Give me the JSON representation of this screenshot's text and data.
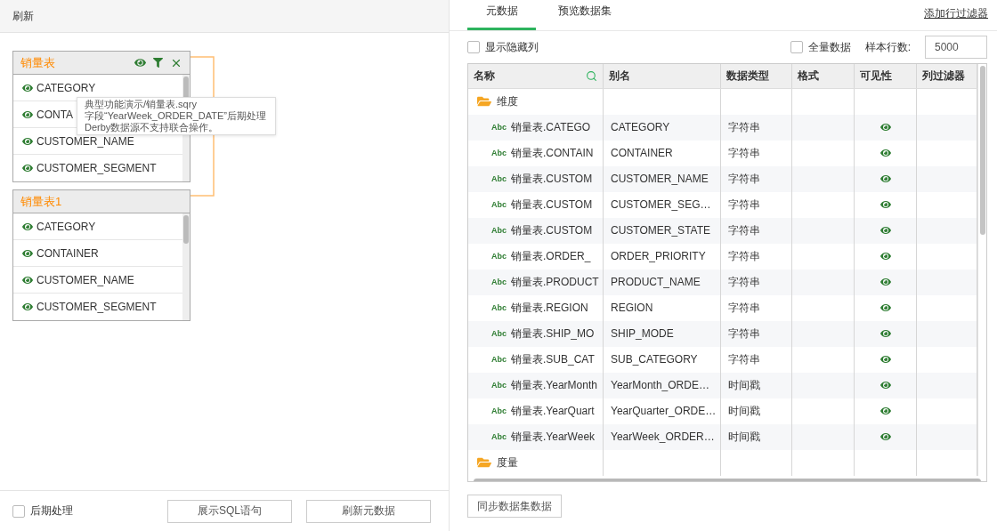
{
  "left_panel": {
    "toolbar": {
      "refresh": "刷新"
    },
    "tables": [
      {
        "title": "销量表",
        "actions": true,
        "fields": [
          {
            "name": "CATEGORY",
            "visible": true
          },
          {
            "name": "CONTA",
            "visible": true
          },
          {
            "name": "CUSTOMER_NAME",
            "visible": true
          },
          {
            "name": "CUSTOMER_SEGMENT",
            "visible": true
          }
        ]
      },
      {
        "title": "销量表1",
        "actions": false,
        "fields": [
          {
            "name": "CATEGORY",
            "visible": true
          },
          {
            "name": "CONTAINER",
            "visible": true
          },
          {
            "name": "CUSTOMER_NAME",
            "visible": true
          },
          {
            "name": "CUSTOMER_SEGMENT",
            "visible": true
          }
        ]
      }
    ],
    "tooltip": [
      "典型功能演示/销量表.sqry",
      "字段“YearWeek_ORDER_DATE”后期处理",
      "Derby数据源不支持联合操作。"
    ],
    "post_process": {
      "label": "后期处理",
      "checked": false
    },
    "buttons": [
      "展示SQL语句",
      "刷新元数据"
    ]
  },
  "right_panel": {
    "tabs": [
      {
        "label": "元数据",
        "selected": true
      },
      {
        "label": "预览数据集",
        "selected": false
      }
    ],
    "add_row_filter": "添加行过滤器",
    "show_hidden": {
      "label": "显示隐藏列",
      "checked": false
    },
    "full_data": {
      "label": "全量数据",
      "checked": false
    },
    "sample_rows": {
      "label": "样本行数:",
      "value": "5000"
    },
    "table": {
      "columns": [
        "名称",
        "别名",
        "数据类型",
        "格式",
        "可见性",
        "列过滤器"
      ],
      "groups": [
        {
          "name": "维度",
          "rows": [
            {
              "name": "销量表.CATEGO",
              "badge": "Abc",
              "alias": "CATEGORY",
              "type": "字符串",
              "visible": true
            },
            {
              "name": "销量表.CONTAIN",
              "badge": "Abc",
              "alias": "CONTAINER",
              "type": "字符串",
              "visible": true
            },
            {
              "name": "销量表.CUSTOM",
              "badge": "Abc",
              "alias": "CUSTOMER_NAME",
              "type": "字符串",
              "visible": true
            },
            {
              "name": "销量表.CUSTOM",
              "badge": "Abc",
              "alias": "CUSTOMER_SEG…",
              "type": "字符串",
              "visible": true
            },
            {
              "name": "销量表.CUSTOM",
              "badge": "Abc",
              "alias": "CUSTOMER_STATE",
              "type": "字符串",
              "visible": true
            },
            {
              "name": "销量表.ORDER_",
              "badge": "Abc",
              "alias": "ORDER_PRIORITY",
              "type": "字符串",
              "visible": true
            },
            {
              "name": "销量表.PRODUCT",
              "badge": "Abc",
              "alias": "PRODUCT_NAME",
              "type": "字符串",
              "visible": true
            },
            {
              "name": "销量表.REGION",
              "badge": "Abc",
              "alias": "REGION",
              "type": "字符串",
              "visible": true
            },
            {
              "name": "销量表.SHIP_MO",
              "badge": "Abc",
              "alias": "SHIP_MODE",
              "type": "字符串",
              "visible": true
            },
            {
              "name": "销量表.SUB_CAT",
              "badge": "Abc",
              "alias": "SUB_CATEGORY",
              "type": "字符串",
              "visible": true
            },
            {
              "name": "销量表.YearMonth",
              "badge": "Abc",
              "alias": "YearMonth_ORDE…",
              "type": "时间戳",
              "visible": true
            },
            {
              "name": "销量表.YearQuart",
              "badge": "Abc",
              "alias": "YearQuarter_ORDE…",
              "type": "时间戳",
              "visible": true
            },
            {
              "name": "销量表.YearWeek",
              "badge": "Abc",
              "alias": "YearWeek_ORDER…",
              "type": "时间戳",
              "visible": true
            }
          ]
        },
        {
          "name": "度量"
        }
      ]
    },
    "sync_button": "同步数据集数据"
  }
}
